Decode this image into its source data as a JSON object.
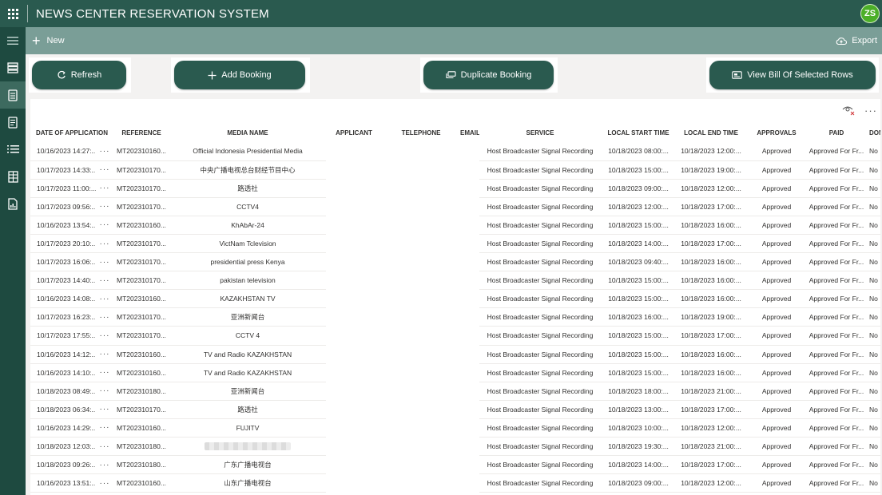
{
  "header": {
    "title": "NEWS CENTER RESERVATION SYSTEM",
    "user_initials": "ZS"
  },
  "sidebar": {
    "items": [
      {
        "name": "menu-toggle",
        "icon": "hamburger-icon"
      },
      {
        "name": "bookings",
        "icon": "server-stack-icon"
      },
      {
        "name": "reservations",
        "icon": "document-icon",
        "active": true
      },
      {
        "name": "reports",
        "icon": "document-lines-icon"
      },
      {
        "name": "list-view",
        "icon": "list-icon"
      },
      {
        "name": "services",
        "icon": "table-icon"
      },
      {
        "name": "billing",
        "icon": "document-chart-icon"
      }
    ]
  },
  "commandbar": {
    "new_label": "New",
    "export_label": "Export"
  },
  "actions": {
    "refresh": "Refresh",
    "add_booking": "Add Booking",
    "duplicate_booking": "Duplicate Booking",
    "view_bill": "View Bill Of Selected Rows"
  },
  "grid": {
    "more": "···",
    "columns": [
      "DATE OF APPLICATION",
      "REFERENCE",
      "MEDIA NAME",
      "APPLICANT",
      "TELEPHONE",
      "EMAIL",
      "SERVICE",
      "LOCAL START TIME",
      "LOCAL END TIME",
      "APPROVALS",
      "PAID",
      "DONI"
    ],
    "rows": [
      {
        "date": "10/16/2023 14:27:...",
        "ref": "MT202310160...",
        "media": "Official Indonesia Presidential Media",
        "service": "Host Broadcaster Signal Recording",
        "start": "10/18/2023 08:00:...",
        "end": "10/18/2023 12:00:...",
        "approval": "Approved",
        "paid": "Approved For Fr...",
        "done": "No"
      },
      {
        "date": "10/17/2023 14:33:...",
        "ref": "MT202310170...",
        "media": "中央广播电视总台财经节目中心",
        "service": "Host Broadcaster Signal Recording",
        "start": "10/18/2023 15:00:...",
        "end": "10/18/2023 19:00:...",
        "approval": "Approved",
        "paid": "Approved For Fr...",
        "done": "No"
      },
      {
        "date": "10/17/2023 11:00:...",
        "ref": "MT202310170...",
        "media": "路透社",
        "service": "Host Broadcaster Signal Recording",
        "start": "10/18/2023 09:00:...",
        "end": "10/18/2023 12:00:...",
        "approval": "Approved",
        "paid": "Approved For Fr...",
        "done": "No"
      },
      {
        "date": "10/17/2023 09:56:...",
        "ref": "MT202310170...",
        "media": "CCTV4",
        "service": "Host Broadcaster Signal Recording",
        "start": "10/18/2023 12:00:...",
        "end": "10/18/2023 17:00:...",
        "approval": "Approved",
        "paid": "Approved For Fr...",
        "done": "No"
      },
      {
        "date": "10/16/2023 13:54:...",
        "ref": "MT202310160...",
        "media": "KhAbAr-24",
        "service": "Host Broadcaster Signal Recording",
        "start": "10/18/2023 15:00:...",
        "end": "10/18/2023 16:00:...",
        "approval": "Approved",
        "paid": "Approved For Fr...",
        "done": "No"
      },
      {
        "date": "10/17/2023 20:10:...",
        "ref": "MT202310170...",
        "media": "VictNam Tclevision",
        "service": "Host Broadcaster Signal Recording",
        "start": "10/18/2023 14:00:...",
        "end": "10/18/2023 17:00:...",
        "approval": "Approved",
        "paid": "Approved For Fr...",
        "done": "No"
      },
      {
        "date": "10/17/2023 16:06:...",
        "ref": "MT202310170...",
        "media": "presidential press Kenya",
        "service": "Host Broadcaster Signal Recording",
        "start": "10/18/2023 09:40:...",
        "end": "10/18/2023 16:00:...",
        "approval": "Approved",
        "paid": "Approved For Fr...",
        "done": "No"
      },
      {
        "date": "10/17/2023 14:40:...",
        "ref": "MT202310170...",
        "media": "pakistan television",
        "service": "Host Broadcaster Signal Recording",
        "start": "10/18/2023 15:00:...",
        "end": "10/18/2023 16:00:...",
        "approval": "Approved",
        "paid": "Approved For Fr...",
        "done": "No"
      },
      {
        "date": "10/16/2023 14:08:...",
        "ref": "MT202310160...",
        "media": "KAZAKHSTAN TV",
        "service": "Host Broadcaster Signal Recording",
        "start": "10/18/2023 15:00:...",
        "end": "10/18/2023 16:00:...",
        "approval": "Approved",
        "paid": "Approved For Fr...",
        "done": "No"
      },
      {
        "date": "10/17/2023 16:23:...",
        "ref": "MT202310170...",
        "media": "亚洲新闻台",
        "service": "Host Broadcaster Signal Recording",
        "start": "10/18/2023 16:00:...",
        "end": "10/18/2023 19:00:...",
        "approval": "Approved",
        "paid": "Approved For Fr...",
        "done": "No"
      },
      {
        "date": "10/17/2023 17:55:...",
        "ref": "MT202310170...",
        "media": "CCTV 4",
        "service": "Host Broadcaster Signal Recording",
        "start": "10/18/2023 15:00:...",
        "end": "10/18/2023 17:00:...",
        "approval": "Approved",
        "paid": "Approved For Fr...",
        "done": "No"
      },
      {
        "date": "10/16/2023 14:12:...",
        "ref": "MT202310160...",
        "media": "TV and Radio KAZAKHSTAN",
        "service": "Host Broadcaster Signal Recording",
        "start": "10/18/2023 15:00:...",
        "end": "10/18/2023 16:00:...",
        "approval": "Approved",
        "paid": "Approved For Fr...",
        "done": "No"
      },
      {
        "date": "10/16/2023 14:10:...",
        "ref": "MT202310160...",
        "media": "TV and Radio KAZAKHSTAN",
        "service": "Host Broadcaster Signal Recording",
        "start": "10/18/2023 15:00:...",
        "end": "10/18/2023 16:00:...",
        "approval": "Approved",
        "paid": "Approved For Fr...",
        "done": "No"
      },
      {
        "date": "10/18/2023 08:49:...",
        "ref": "MT202310180...",
        "media": "亚洲新闻台",
        "service": "Host Broadcaster Signal Recording",
        "start": "10/18/2023 18:00:...",
        "end": "10/18/2023 21:00:...",
        "approval": "Approved",
        "paid": "Approved For Fr...",
        "done": "No"
      },
      {
        "date": "10/18/2023 06:34:...",
        "ref": "MT202310170...",
        "media": "路透社",
        "service": "Host Broadcaster Signal Recording",
        "start": "10/18/2023 13:00:...",
        "end": "10/18/2023 17:00:...",
        "approval": "Approved",
        "paid": "Approved For Fr...",
        "done": "No"
      },
      {
        "date": "10/16/2023 14:29:...",
        "ref": "MT202310160...",
        "media": "FUJITV",
        "service": "Host Broadcaster Signal Recording",
        "start": "10/18/2023 10:00:...",
        "end": "10/18/2023 12:00:...",
        "approval": "Approved",
        "paid": "Approved For Fr...",
        "done": "No"
      },
      {
        "date": "10/18/2023 12:03:...",
        "ref": "MT202310180...",
        "media": "",
        "service": "Host Broadcaster Signal Recording",
        "start": "10/18/2023 19:30:...",
        "end": "10/18/2023 21:00:...",
        "approval": "Approved",
        "paid": "Approved For Fr...",
        "done": "No"
      },
      {
        "date": "10/18/2023 09:26:...",
        "ref": "MT202310180...",
        "media": "广东广播电视台",
        "service": "Host Broadcaster Signal Recording",
        "start": "10/18/2023 14:00:...",
        "end": "10/18/2023 17:00:...",
        "approval": "Approved",
        "paid": "Approved For Fr...",
        "done": "No"
      },
      {
        "date": "10/16/2023 13:51:...",
        "ref": "MT202310160...",
        "media": "山东广播电视台",
        "service": "Host Broadcaster Signal Recording",
        "start": "10/18/2023 09:00:...",
        "end": "10/18/2023 12:00:...",
        "approval": "Approved",
        "paid": "Approved For Fr...",
        "done": "No"
      }
    ]
  },
  "colors": {
    "header": "#2a5a4f",
    "sidebar": "#1e4a40",
    "commandbar": "#7a9e97",
    "button": "#2a5a4f",
    "avatar": "#4caf28"
  }
}
